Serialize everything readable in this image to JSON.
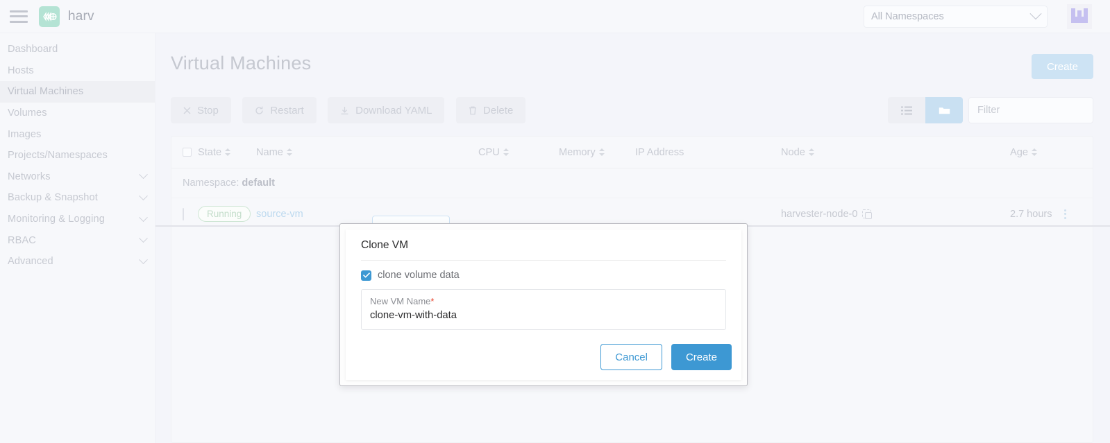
{
  "topbar": {
    "menu_icon": "hamburger-icon",
    "brand_icon": "harvester-logo-icon",
    "brand_name": "harv",
    "namespace_selector": "All Namespaces",
    "avatar_icon": "user-avatar-icon"
  },
  "sidebar": {
    "items": [
      {
        "label": "Dashboard",
        "active": false,
        "expandable": false
      },
      {
        "label": "Hosts",
        "active": false,
        "expandable": false
      },
      {
        "label": "Virtual Machines",
        "active": true,
        "expandable": false
      },
      {
        "label": "Volumes",
        "active": false,
        "expandable": false
      },
      {
        "label": "Images",
        "active": false,
        "expandable": false
      },
      {
        "label": "Projects/Namespaces",
        "active": false,
        "expandable": false
      },
      {
        "label": "Networks",
        "active": false,
        "expandable": true
      },
      {
        "label": "Backup & Snapshot",
        "active": false,
        "expandable": true
      },
      {
        "label": "Monitoring & Logging",
        "active": false,
        "expandable": true
      },
      {
        "label": "RBAC",
        "active": false,
        "expandable": true
      },
      {
        "label": "Advanced",
        "active": false,
        "expandable": true
      }
    ]
  },
  "main": {
    "page_title": "Virtual Machines",
    "create_button": "Create",
    "toolbar": {
      "stop": "Stop",
      "restart": "Restart",
      "download_yaml": "Download YAML",
      "delete": "Delete",
      "list_view_icon": "list-view-icon",
      "group_view_icon": "folder-view-icon",
      "filter_placeholder": "Filter"
    },
    "table": {
      "columns": [
        "State",
        "Name",
        "CPU",
        "Memory",
        "IP Address",
        "Node",
        "Age"
      ],
      "group_label": "Namespace:",
      "group_value": "default",
      "rows": [
        {
          "state": "Running",
          "name": "source-vm",
          "cpu": "",
          "memory": "",
          "ip_address": "",
          "node": "harvester-node-0",
          "age": "2.7 hours"
        }
      ]
    }
  },
  "modal": {
    "title": "Clone VM",
    "checkbox_label": "clone volume data",
    "checkbox_checked": true,
    "field_label": "New VM Name",
    "field_required_mark": "*",
    "field_value": "clone-vm-with-data",
    "cancel_button": "Cancel",
    "create_button": "Create"
  },
  "colors": {
    "accent_blue": "#3d98d3",
    "brand_green": "#b4e3d4",
    "required_red": "#e8462f",
    "avatar_purple": "#c5c0f0"
  }
}
